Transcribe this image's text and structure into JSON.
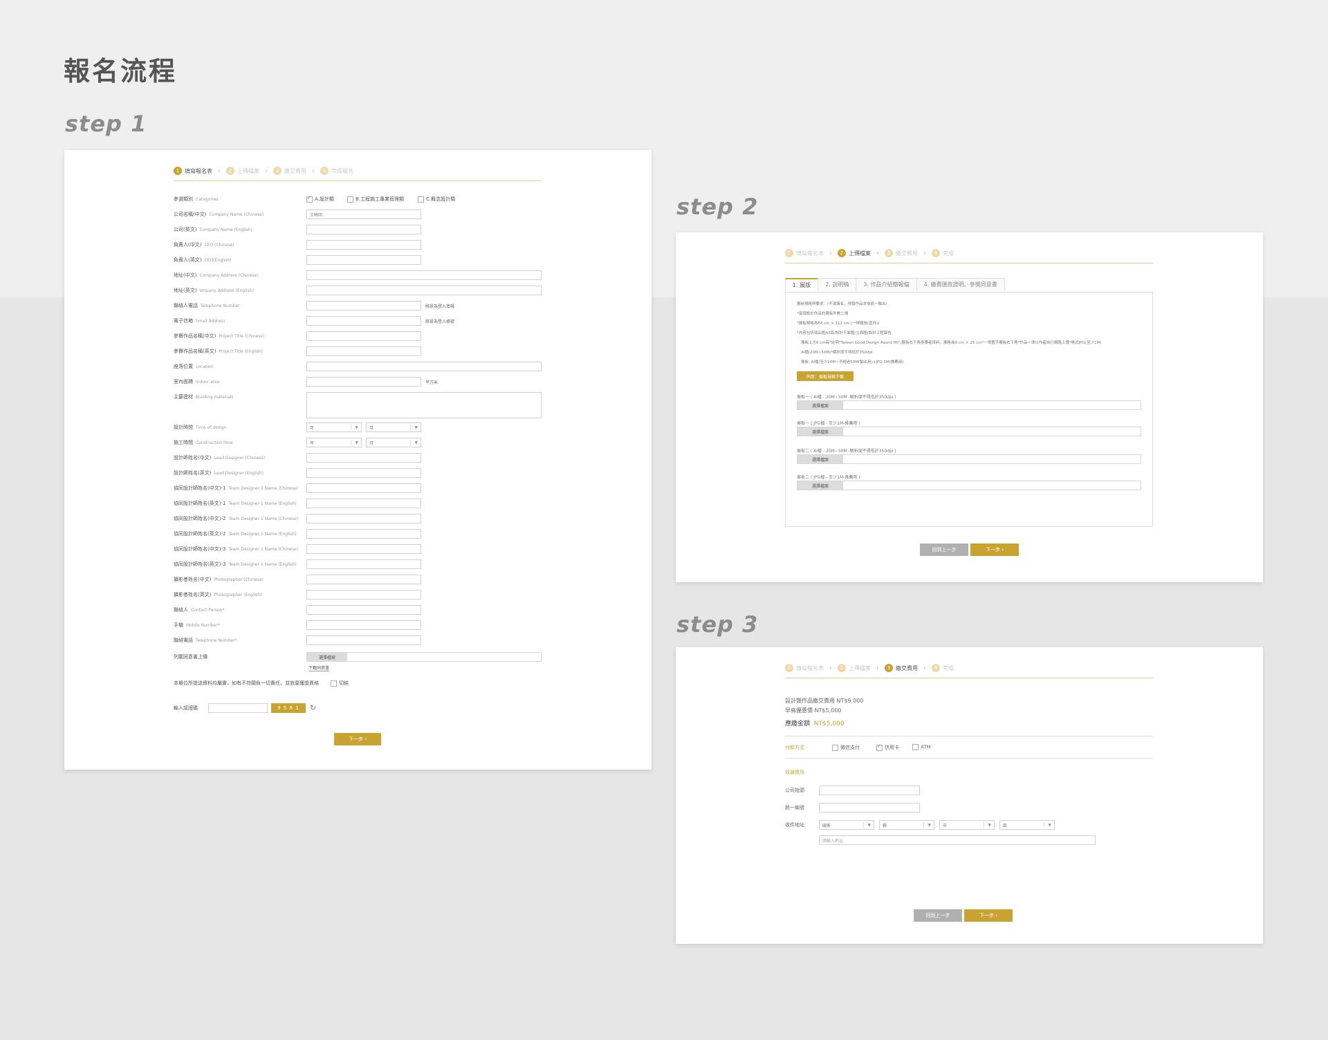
{
  "page_title": "報名流程",
  "steps": [
    "step 1",
    "step 2",
    "step 3"
  ],
  "progress": {
    "items": [
      {
        "num": "1",
        "label": "填寫報名表"
      },
      {
        "num": "2",
        "label": "上傳檔案"
      },
      {
        "num": "3",
        "label": "繳交費用"
      },
      {
        "num": "4",
        "label": "完成報名"
      }
    ],
    "items_short_last": "完成"
  },
  "step1": {
    "categories_label": "參選類別",
    "categories_en": "Categories",
    "category_options": [
      "A.設計類",
      "B.工程施工專業管理類",
      "C.概念設計類"
    ],
    "fields": [
      {
        "label": "公司名稱(中文)",
        "en": "Company Name (Chinese)",
        "value": "王曉明",
        "width": "short"
      },
      {
        "label": "公司(英文)",
        "en": "Company Name (English)",
        "value": "",
        "width": "short"
      },
      {
        "label": "負責人(中文)",
        "en": "CEO (Chinese)",
        "value": "",
        "width": "short"
      },
      {
        "label": "負責人(英文)",
        "en": "CEO(English)",
        "value": "",
        "width": "short"
      },
      {
        "label": "地址(中文)",
        "en": "Company Address (Chinese)",
        "value": "",
        "width": "long"
      },
      {
        "label": "地址(英文)",
        "en": "ompany Address (English)",
        "value": "",
        "width": "long"
      },
      {
        "label": "聯絡人電話",
        "en": "Telephone Number",
        "value": "",
        "width": "short",
        "note": "將設為登入密碼"
      },
      {
        "label": "電子信箱",
        "en": "Email Address",
        "value": "",
        "width": "short",
        "note": "將設為登入帳號"
      },
      {
        "label": "參賽作品名稱(中文)",
        "en": "Project Title (Chinese)",
        "value": "",
        "width": "short"
      },
      {
        "label": "參賽作品名稱(英文)",
        "en": "Project Title (English)",
        "value": "",
        "width": "short"
      },
      {
        "label": "座落位置",
        "en": "Location",
        "value": "",
        "width": "long"
      },
      {
        "label": "室內面積",
        "en": "Indoor area",
        "value": "",
        "width": "short",
        "note": "平方米"
      }
    ],
    "materials_label": "主要建材",
    "materials_en": "Building materials",
    "time_fields": [
      {
        "label": "設計時間",
        "en": "Time of design",
        "year": "年",
        "month": "月"
      },
      {
        "label": "施工時間",
        "en": "Construction time",
        "year": "年",
        "month": "月"
      }
    ],
    "fields2": [
      {
        "label": "設計師姓名(中文)",
        "en": "Lead Designer (Chinese)"
      },
      {
        "label": "設計師姓名(英文)",
        "en": "Lead Designer (English)"
      },
      {
        "label": "協同設計師姓名(中文)-1",
        "en": "Team Designer 1 Name (Chinese)"
      },
      {
        "label": "協同設計師姓名(英文)-1",
        "en": "Team Designer 1 Name (English)"
      },
      {
        "label": "協同設計師姓名(中文)-2",
        "en": "Team Designer 1 Name (Chinese)"
      },
      {
        "label": "協同設計師姓名(英文)-2",
        "en": "Team Designer 1 Name (English)"
      },
      {
        "label": "協同設計師姓名(中文)-3",
        "en": "Team Designer 1 Name (Chinese)"
      },
      {
        "label": "協同設計師姓名(英文)-3",
        "en": "Team Designer 1 Name (English)"
      },
      {
        "label": "攝影者姓名(中文)",
        "en": "Photographer (Chinese)"
      },
      {
        "label": "攝影者姓名(英文)",
        "en": "Photographer (English)"
      },
      {
        "label": "聯絡人",
        "en": "Contact Person*"
      },
      {
        "label": "手機",
        "en": "Mobile Number*"
      },
      {
        "label": "聯絡電話",
        "en": "Telephone Number*"
      }
    ],
    "consent_upload_label": "列載同意書上傳",
    "choose_file": "選擇檔案",
    "download_consent": "下載同意書",
    "declaration": "本單位所提送資料均屬實，如有不符願負一切責任，並放棄獲獎資格",
    "declaration_check": "切結",
    "captcha_label": "輸入認證碼",
    "captcha_code": "9 5 6 1",
    "next": "下一步"
  },
  "step2": {
    "tabs": [
      "1. 展版",
      "2. 說明稿",
      "3. 作品介紹簡報檔",
      "4. 繳費匯款證明、參獎同意書"
    ],
    "lines": [
      "展板規格與要求：(不須報名，得獎作品本會統一輸出)",
      "*每項設計作品的展板件數二塊",
      "*展板規格為84 cm × 112 cm (一律擺放(直向))",
      "*內容包括項品框A3頁/設計平面圖/立面圖/設計工程報告",
      "展板上方6 cm高*註明\"Taiwan Good Design Award fth\"/展板右下角參賽者資料，展格為8 cm × 25 cm*一律置手展板右下角*作品一律以作者自行網路上傳*格式JPG(至少1M)",
      "AI檔(20M~50M)*解析度不得低於350dpi",
      "展板: AI檔/至少20M~不超過50M(輸出用)+JPG-1M(推薦用)"
    ],
    "download_btn": "同意：展板規格下載",
    "uploads": [
      "展板一 ( AI檔 - 20M~50M -解析度不得低於350dpi )",
      "展板一 ( JPG檔 - 至少1M-推薦用 )",
      "展板二 ( AI檔 - 20M~50M -解析度不得低於350dpi )",
      "展板二 ( JPG檔 - 至少1M-推薦用 )"
    ],
    "choose_file": "選擇檔案",
    "back": "回到上一步",
    "next": "下一步"
  },
  "step3": {
    "fee_line1": "設計類作品繳交費用 NT$9,000",
    "fee_line2": "早鳥優惠價 NT$5,000",
    "total_label": "應繳金額",
    "total_value": "NT$5,000",
    "payment_label": "付款方式",
    "payment_options": [
      "微信支付",
      "信用卡",
      "ATM"
    ],
    "invoice_label": "收據資訊",
    "company_label": "公司抬頭",
    "tax_label": "統一編號",
    "address_label": "收件地址",
    "address_selects": [
      "國家",
      "縣",
      "市",
      "區"
    ],
    "address_placeholder": "請輸入地址",
    "back": "回到上一步",
    "next": "下一步"
  },
  "colors": {
    "accent": "#c9a32f",
    "accent_light": "#ecdba8",
    "bg": "#efeff0"
  }
}
